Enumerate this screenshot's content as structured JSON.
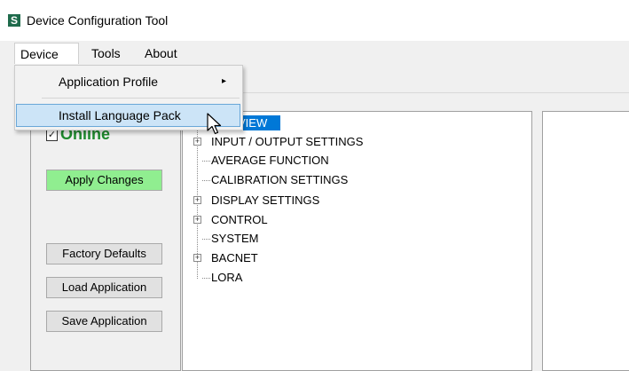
{
  "window": {
    "title": "Device Configuration Tool",
    "icon_letter": "S"
  },
  "menubar": {
    "items": [
      {
        "label": "Device"
      },
      {
        "label": "Tools"
      },
      {
        "label": "About"
      }
    ]
  },
  "device_menu": {
    "items": [
      {
        "label": "Application Profile",
        "submenu_arrow": "▸"
      },
      {
        "label": "Install Language Pack"
      }
    ]
  },
  "left_panel": {
    "status_label": "Online",
    "status_checked": true,
    "status_color": "#1e8a2e",
    "buttons": {
      "apply": "Apply Changes",
      "factory": "Factory Defaults",
      "load": "Load Application",
      "save": "Save Application"
    }
  },
  "tree": {
    "selected_partial_label": "VIEW",
    "items": [
      {
        "label": "INPUT / OUTPUT SETTINGS",
        "expandable": true
      },
      {
        "label": "AVERAGE FUNCTION",
        "expandable": false
      },
      {
        "label": "CALIBRATION SETTINGS",
        "expandable": false
      },
      {
        "label": "DISPLAY SETTINGS",
        "expandable": true
      },
      {
        "label": "CONTROL",
        "expandable": true
      },
      {
        "label": "SYSTEM",
        "expandable": false
      },
      {
        "label": "BACNET",
        "expandable": true
      },
      {
        "label": "LORA",
        "expandable": false
      }
    ]
  },
  "colors": {
    "selection": "#0078d7",
    "apply_button": "#90ee90",
    "menu_hover": "#cce4f7"
  }
}
